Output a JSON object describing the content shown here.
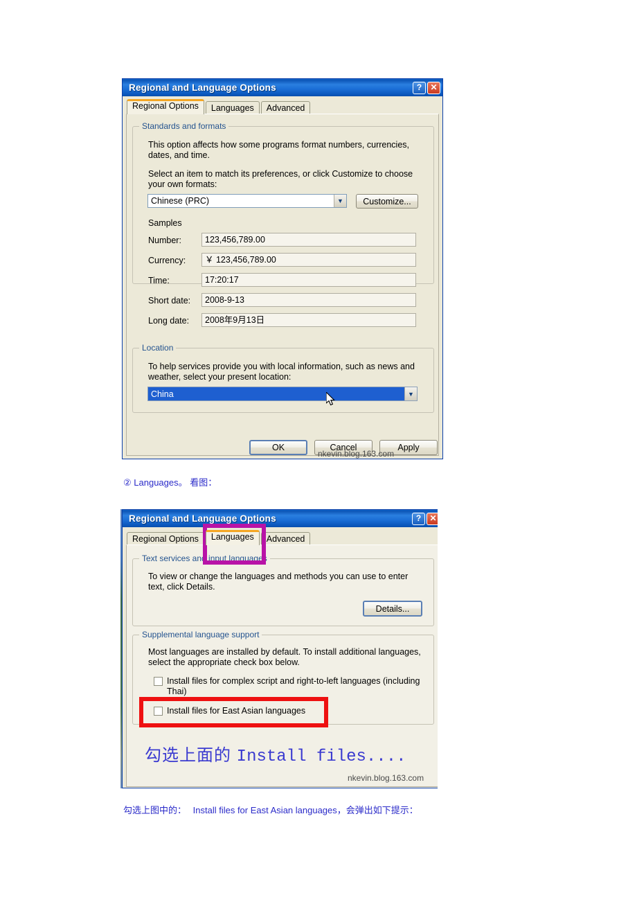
{
  "page": {
    "background": "#ffffff"
  },
  "screenshot1": {
    "title": "Regional and Language Options",
    "titlebar_buttons": [
      {
        "name": "help",
        "glyph": "?"
      },
      {
        "name": "close",
        "glyph": "✕"
      }
    ],
    "tabs": [
      {
        "label": "Regional Options",
        "active": true
      },
      {
        "label": "Languages",
        "active": false
      },
      {
        "label": "Advanced",
        "active": false
      }
    ],
    "standards_group": {
      "legend": "Standards and formats",
      "desc1": "This option affects how some programs format numbers, currencies,",
      "desc2": "dates, and time.",
      "desc3": "Select an item to match its preferences, or click Customize to choose",
      "desc4": "your own formats:",
      "locale_value": "Chinese (PRC)",
      "customize_button": "Customize...",
      "samples_label": "Samples",
      "samples": [
        {
          "label": "Number:",
          "value": "123,456,789.00"
        },
        {
          "label": "Currency:",
          "value": "￥ 123,456,789.00"
        },
        {
          "label": "Time:",
          "value": "17:20:17"
        },
        {
          "label": "Short date:",
          "value": "2008-9-13"
        },
        {
          "label": "Long date:",
          "value": "2008年9月13日"
        }
      ]
    },
    "location_group": {
      "legend": "Location",
      "desc1": "To help services provide you with local information, such as news and",
      "desc2": "weather, select your present location:",
      "value": "China"
    },
    "buttons": {
      "ok": "OK",
      "cancel": "Cancel",
      "apply": "Apply"
    },
    "watermark": "nkevin.blog.163.com"
  },
  "caption1": {
    "prefix": "②",
    "link": "Languages",
    "suffix": "。  看图："
  },
  "screenshot2": {
    "title": "Regional and Language Options",
    "titlebar_buttons": [
      {
        "name": "help",
        "glyph": "?"
      },
      {
        "name": "close",
        "glyph": "✕"
      }
    ],
    "tabs": [
      {
        "label": "Regional Options",
        "active": false
      },
      {
        "label": "Languages",
        "active": true
      },
      {
        "label": "Advanced",
        "active": false
      }
    ],
    "text_services_group": {
      "legend": "Text services and input languages",
      "desc1": "To view or change the languages and methods you can use to enter",
      "desc2": "text, click Details.",
      "details_button": "Details..."
    },
    "supplemental_group": {
      "legend": "Supplemental language support",
      "desc1": "Most languages are installed by default. To install additional languages,",
      "desc2": "select the appropriate check box below.",
      "checkboxes": [
        {
          "label_line1": "Install files for complex script and right-to-left languages (including",
          "label_line2": "Thai)",
          "checked": false
        },
        {
          "label_line1": "Install files for East Asian languages",
          "label_line2": "",
          "checked": false
        }
      ]
    },
    "big_caption_cjk": "勾选上面的",
    "big_caption_en": "Install files....",
    "watermark": "nkevin.blog.163.com",
    "annotations": {
      "magenta_color": "#b813a7",
      "red_color": "#ee1111"
    }
  },
  "caption2": {
    "lead": "勾选上图中的：",
    "emphasis": "Install files for East Asian languages",
    "tail": "，会弹出如下提示："
  }
}
